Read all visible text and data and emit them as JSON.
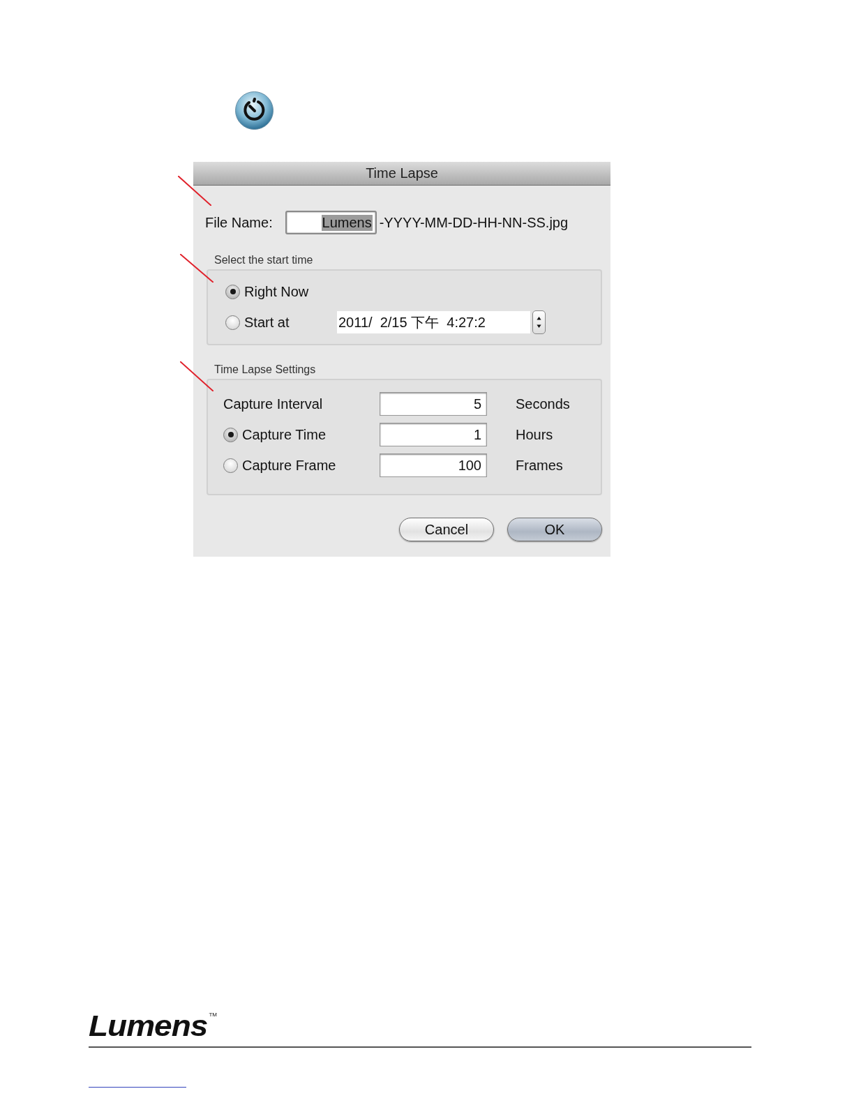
{
  "dialog": {
    "title": "Time Lapse",
    "file_name": {
      "label": "File Name:",
      "value": "Lumens",
      "value_selected": true,
      "suffix": "-YYYY-MM-DD-HH-NN-SS.jpg"
    },
    "start_time": {
      "title": "Select the start time",
      "options": [
        {
          "label": "Right Now",
          "selected": true
        },
        {
          "label": "Start at",
          "selected": false,
          "value": "2011/  2/15 下午  4:27:2"
        }
      ]
    },
    "settings": {
      "title": "Time Lapse Settings",
      "rows": [
        {
          "kind": "plain",
          "label": "Capture Interval",
          "value": "5",
          "unit": "Seconds"
        },
        {
          "kind": "radio",
          "label": "Capture Time",
          "selected": true,
          "value": "1",
          "unit": "Hours"
        },
        {
          "kind": "radio",
          "label": "Capture Frame",
          "selected": false,
          "value": "100",
          "unit": "Frames"
        }
      ]
    },
    "buttons": [
      {
        "label": "Cancel",
        "default": false
      },
      {
        "label": "OK",
        "default": true
      }
    ]
  },
  "footer": {
    "logo": "Lumens",
    "trademark": "TM"
  }
}
